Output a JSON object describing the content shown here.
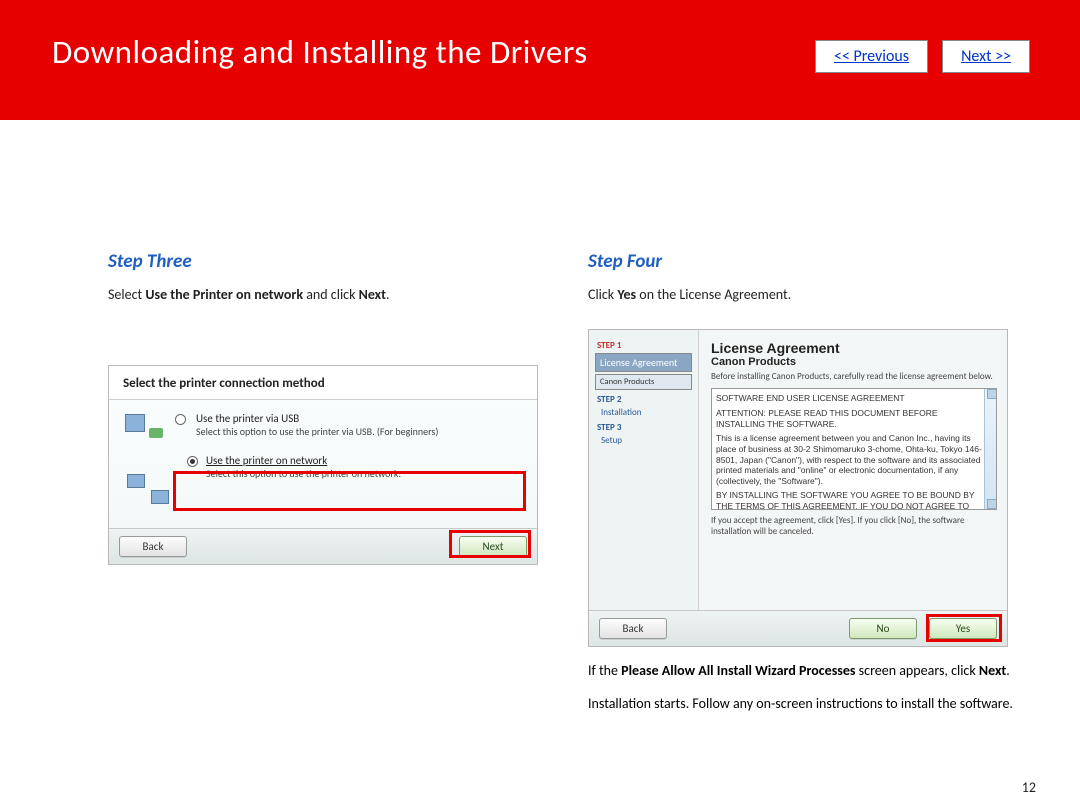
{
  "header": {
    "title": "Downloading and Installing  the Drivers",
    "prev": "<< Previous",
    "next": "Next >>"
  },
  "left": {
    "step_title": "Step Three",
    "descr_pre": "Select ",
    "descr_b1": "Use the Printer on network",
    "descr_mid": " and click ",
    "descr_b2": "Next",
    "descr_end": ".",
    "shot": {
      "title": "Select the printer connection method",
      "opt1_label": "Use the printer via USB",
      "opt1_sub": "Select this option to use the printer via USB. (For beginners)",
      "opt2_label": "Use the printer on network",
      "opt2_sub": "Select this option to use the printer on network.",
      "back": "Back",
      "next": "Next"
    }
  },
  "right": {
    "step_title": "Step Four",
    "descr_pre": "Click ",
    "descr_b1": "Yes",
    "descr_end": " on the License Agreement.",
    "shot": {
      "side": {
        "s1": "STEP 1",
        "s1a": "License Agreement",
        "s1b": "Canon Products",
        "s2": "STEP 2",
        "s2a": "Installation",
        "s3": "STEP 3",
        "s3a": "Setup"
      },
      "la_title": "License Agreement",
      "la_sub": "Canon Products",
      "la_lead": "Before installing Canon Products, carefully read the license agreement below.",
      "la_body1": "SOFTWARE END USER LICENSE AGREEMENT",
      "la_body2": "ATTENTION: PLEASE READ THIS DOCUMENT BEFORE INSTALLING THE SOFTWARE.",
      "la_body3": "This is a license agreement between you and Canon Inc., having its place of business at 30-2 Shimomaruko 3-chome, Ohta-ku, Tokyo 146-8501, Japan (\"Canon\"), with respect to the software and its associated printed materials and \"online\" or electronic documentation, if any (collectively, the \"Software\").",
      "la_body4": "BY INSTALLING THE SOFTWARE YOU AGREE TO BE BOUND BY THE TERMS OF THIS AGREEMENT. IF YOU DO NOT AGREE TO THE TERMS",
      "la_note": "If you accept the agreement, click [Yes]. If you click [No], the software installation will be canceled.",
      "back": "Back",
      "no": "No",
      "yes": "Yes"
    },
    "after1_pre": "If the ",
    "after1_b": "Please Allow All Install Wizard Processes",
    "after1_mid": " screen appears, click ",
    "after1_b2": "Next",
    "after1_end": ".",
    "after2": "Installation starts. Follow any on-screen instructions to install the software."
  },
  "page_number": "12"
}
